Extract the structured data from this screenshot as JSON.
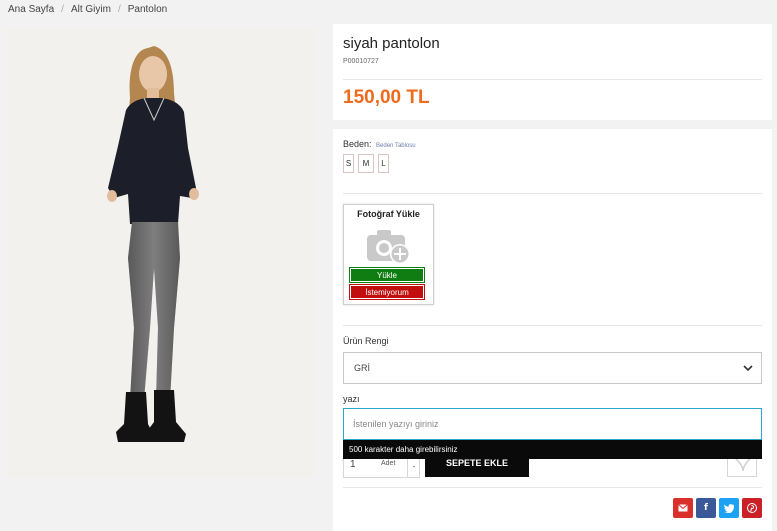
{
  "breadcrumb": {
    "home": "Ana Sayfa",
    "category": "Alt Giyim",
    "current": "Pantolon",
    "separator": "/"
  },
  "product": {
    "title": "siyah pantolon",
    "code": "P00010727",
    "price": "150,00 TL",
    "price_color": "#ee6b1e"
  },
  "size": {
    "label": "Beden:",
    "table_link": "Beden Tablosu",
    "options": [
      "S",
      "M",
      "L"
    ]
  },
  "upload": {
    "title": "Fotoğraf Yükle",
    "upload_label": "Yükle",
    "decline_label": "İstemiyorum",
    "upload_color": "#0f7d12",
    "decline_color": "#c20e0e"
  },
  "color_select": {
    "label": "Ürün Rengi",
    "value": "GRİ"
  },
  "text_field": {
    "label": "yazı",
    "placeholder": "İstenilen yazıyı giriniz",
    "hint": "500 karakter daha girebilirsiniz"
  },
  "cart": {
    "quantity": "1",
    "quantity_label": "Adet",
    "minus": "-",
    "add_label": "SEPETE EKLE"
  },
  "share": {
    "icons": [
      "mail-icon",
      "facebook-icon",
      "twitter-icon",
      "pinterest-icon"
    ],
    "colors": [
      "#d9302b",
      "#3b5998",
      "#1da1f2",
      "#cb2027"
    ]
  }
}
